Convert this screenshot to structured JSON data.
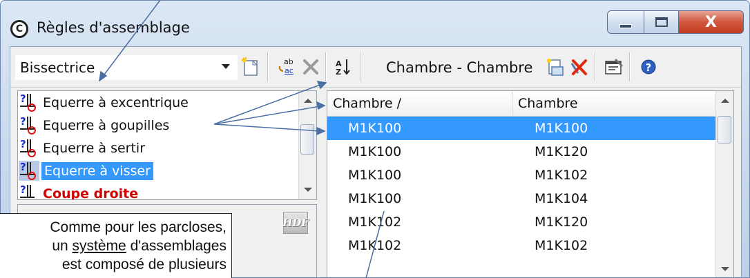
{
  "window": {
    "title": "Règles d'assemblage",
    "app_icon_glyph": "C",
    "close_glyph": "X"
  },
  "toolbar": {
    "combo_value": "Bissectrice",
    "pair_label": "Chambre - Chambre"
  },
  "left_list": {
    "items": [
      {
        "label": "Equerre à excentrique"
      },
      {
        "label": "Equerre à goupilles"
      },
      {
        "label": "Equerre à sertir"
      },
      {
        "label": "Equerre à visser",
        "selected": true
      },
      {
        "label": "Coupe droite"
      }
    ]
  },
  "left_lower": {
    "icon_label": "HDF"
  },
  "grid": {
    "columns": [
      "Chambre ∕",
      "Chambre"
    ],
    "rows": [
      [
        "M1K100",
        "M1K100"
      ],
      [
        "M1K100",
        "M1K120"
      ],
      [
        "M1K100",
        "M1K102"
      ],
      [
        "M1K100",
        "M1K104"
      ],
      [
        "M1K102",
        "M1K120"
      ],
      [
        "M1K102",
        "M1K102"
      ]
    ]
  },
  "callout": {
    "line1": "Comme pour les parcloses,",
    "line2_prefix": "un ",
    "line2_link": "système",
    "line2_suffix": " d'assemblages",
    "line3": "est composé de plusieurs"
  },
  "colors": {
    "selection": "#3399ff",
    "annotation_arrow": "#4a6fa5",
    "error_red": "#d00000"
  }
}
